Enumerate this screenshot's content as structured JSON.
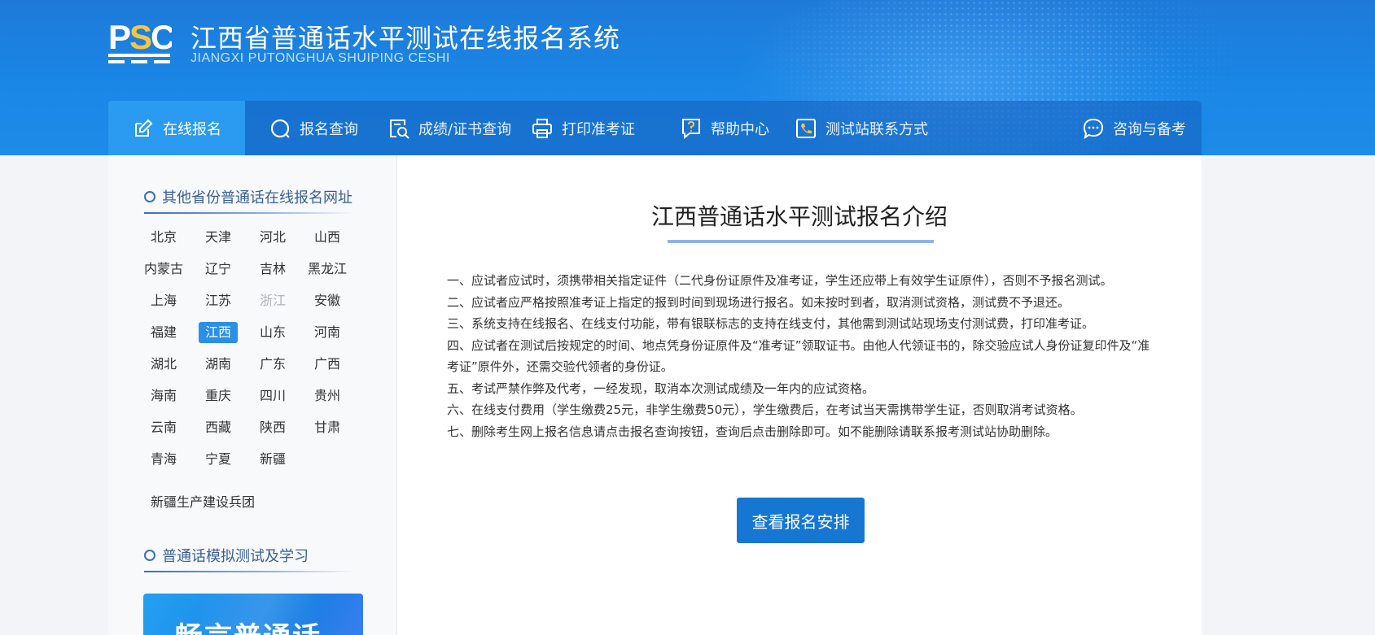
{
  "header": {
    "logo_text": "PSC",
    "title": "江西省普通话水平测试在线报名系统",
    "subtitle": "JIANGXI PUTONGHUA SHUIPING CESHI"
  },
  "nav": {
    "items": [
      {
        "label": "在线报名",
        "icon": "edit-icon",
        "active": true
      },
      {
        "label": "报名查询",
        "icon": "search-icon"
      },
      {
        "label": "成绩/证书查询",
        "icon": "certificate-search-icon"
      },
      {
        "label": "打印准考证",
        "icon": "printer-icon"
      },
      {
        "label": "帮助中心",
        "icon": "help-icon"
      },
      {
        "label": "测试站联系方式",
        "icon": "contact-phone-icon"
      },
      {
        "label": "咨询与备考",
        "icon": "chat-bubble-icon"
      }
    ]
  },
  "sidebar": {
    "provinces_heading": "其他省份普通话在线报名网址",
    "provinces": [
      "北京",
      "天津",
      "河北",
      "山西",
      "内蒙古",
      "辽宁",
      "吉林",
      "黑龙江",
      "上海",
      "江苏",
      "浙江",
      "安徽",
      "福建",
      "江西",
      "山东",
      "河南",
      "湖北",
      "湖南",
      "广东",
      "广西",
      "海南",
      "重庆",
      "四川",
      "贵州",
      "云南",
      "西藏",
      "陕西",
      "甘肃",
      "青海",
      "宁夏",
      "新疆"
    ],
    "selected_province": "江西",
    "disabled_province": "浙江",
    "corps": "新疆生产建设兵团",
    "study_heading": "普通话模拟测试及学习",
    "banner_text": "畅言普通话"
  },
  "main": {
    "title": "江西普通话水平测试报名介绍",
    "notices": [
      "一、应试者应试时，须携带相关指定证件（二代身份证原件及准考证，学生还应带上有效学生证原件），否则不予报名测试。",
      "二、应试者应严格按照准考证上指定的报到时间到现场进行报名。如未按时到者，取消测试资格，测试费不予退还。",
      "三、系统支持在线报名、在线支付功能，带有银联标志的支持在线支付，其他需到测试站现场支付测试费，打印准考证。",
      "四、应试者在测试后按规定的时间、地点凭身份证原件及“准考证”领取证书。由他人代领证书的，除交验应试人身份证复印件及“准考证”原件外，还需交验代领者的身份证。",
      "五、考试严禁作弊及代考，一经发现，取消本次测试成绩及一年内的应试资格。",
      "六、在线支付费用（学生缴费25元，非学生缴费50元），学生缴费后，在考试当天需携带学生证，否则取消考试资格。",
      "七、删除考生网上报名信息请点击报名查询按钮，查询后点击删除即可。如不能删除请联系报考测试站协助删除。"
    ],
    "cta_label": "查看报名安排"
  },
  "colors": {
    "header_blue": "#1a86e6",
    "nav_active": "#2a9bf0",
    "accent_button": "#1677d2",
    "selected_province": "#2a8fe6",
    "heading_blue": "#3a5f96"
  }
}
